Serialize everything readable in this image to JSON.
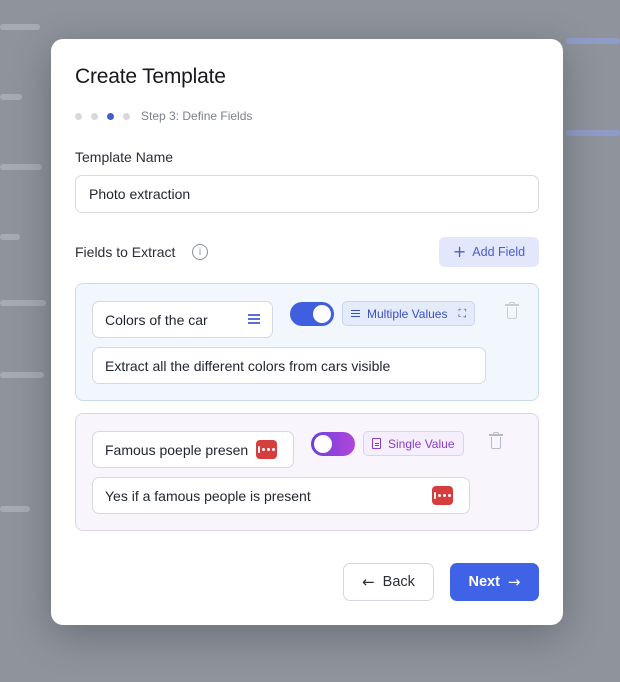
{
  "modal": {
    "title": "Create Template",
    "steps": {
      "total": 4,
      "current": 3,
      "label": "Step 3: Define Fields"
    },
    "template_name": {
      "label": "Template Name",
      "value": "Photo extraction"
    },
    "fields_section": {
      "label": "Fields to Extract",
      "info_icon": "info-icon",
      "add_button": "Add Field"
    },
    "fields": [
      {
        "name": "Colors of the car",
        "toggle_on": true,
        "value_type": "Multiple Values",
        "description": "Extract all the different colors from cars visible",
        "accent": "#3f5fdf"
      },
      {
        "name": "Famous poeple presen",
        "toggle_on": false,
        "value_type": "Single Value",
        "description": "Yes if a famous people is present",
        "accent": "#8a3cc7"
      }
    ],
    "footer": {
      "back": "Back",
      "next": "Next"
    }
  },
  "colors": {
    "primary": "#3f62e6",
    "purple": "#8a3cc7",
    "badge_red": "#d63e3e"
  }
}
